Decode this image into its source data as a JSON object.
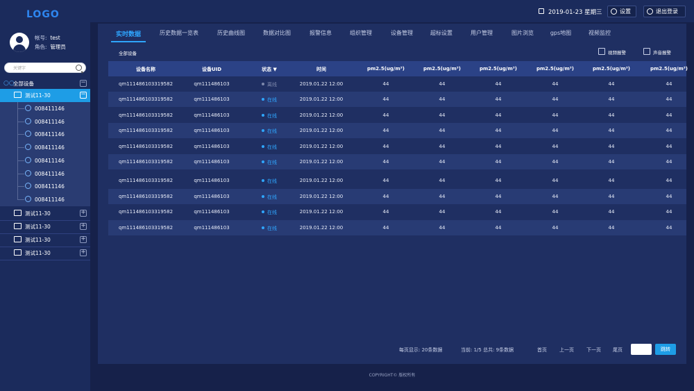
{
  "app": {
    "logo": "LOGO"
  },
  "user": {
    "account_label": "帐号:",
    "account": "test",
    "role_label": "角色:",
    "role": "管理员"
  },
  "search": {
    "placeholder": "关键字"
  },
  "tree": {
    "root": {
      "label": "全部设备",
      "toggle": "−"
    },
    "groups": [
      {
        "label": "测试11-30",
        "toggle": "−",
        "expanded": true
      },
      {
        "label": "测试11-30",
        "toggle": "+"
      },
      {
        "label": "测试11-30",
        "toggle": "+"
      },
      {
        "label": "测试11-30",
        "toggle": "+"
      },
      {
        "label": "测试11-30",
        "toggle": "+"
      }
    ],
    "devices": [
      "008411146",
      "008411146",
      "008411146",
      "008411146",
      "008411146",
      "008411146",
      "008411146",
      "008411146"
    ]
  },
  "topbar": {
    "date": "2019-01-23 星期三",
    "settings": "设置",
    "logout": "退出登录"
  },
  "tabs": [
    "实时数据",
    "历史数据一览表",
    "历史曲线图",
    "数据对比图",
    "报警信息",
    "组织管理",
    "设备管理",
    "超标设置",
    "用户管理",
    "图片浏览",
    "gps地图",
    "视频监控"
  ],
  "active_tab": 0,
  "subheader": {
    "title": "全部设备",
    "video_alarm": "视频报警",
    "sound_alarm": "声音报警"
  },
  "table": {
    "headers": [
      "设备名称",
      "设备UID",
      "状态 ▼",
      "时间",
      "pm2.5(ug/m³)",
      "pm2.5(ug/m³)",
      "pm2.5(ug/m³)",
      "pm2.5(ug/m³)",
      "pm2.5(ug/m³)",
      "pm2.5(ug/m³)"
    ],
    "rows": [
      {
        "name": "qm111486103319582",
        "uid": "qm111486103",
        "status": "离线",
        "online": false,
        "time": "2019.01.22  12:00",
        "vals": [
          "44",
          "44",
          "44",
          "44",
          "44",
          "44"
        ]
      },
      {
        "name": "qm111486103319582",
        "uid": "qm111486103",
        "status": "在线",
        "online": true,
        "time": "2019.01.22  12:00",
        "vals": [
          "44",
          "44",
          "44",
          "44",
          "44",
          "44"
        ]
      },
      {
        "name": "qm111486103319582",
        "uid": "qm111486103",
        "status": "在线",
        "online": true,
        "time": "2019.01.22  12:00",
        "vals": [
          "44",
          "44",
          "44",
          "44",
          "44",
          "44"
        ]
      },
      {
        "name": "qm111486103319582",
        "uid": "qm111486103",
        "status": "在线",
        "online": true,
        "time": "2019.01.22  12:00",
        "vals": [
          "44",
          "44",
          "44",
          "44",
          "44",
          "44"
        ]
      },
      {
        "name": "qm111486103319582",
        "uid": "qm111486103",
        "status": "在线",
        "online": true,
        "time": "2019.01.22  12:00",
        "vals": [
          "44",
          "44",
          "44",
          "44",
          "44",
          "44"
        ]
      },
      {
        "name": "qm111486103319582",
        "uid": "qm111486103",
        "status": "在线",
        "online": true,
        "time": "2019.01.22  12:00",
        "vals": [
          "44",
          "44",
          "44",
          "44",
          "44",
          "44"
        ]
      },
      {
        "name": "qm111486103319582",
        "uid": "qm111486103",
        "status": "在线",
        "online": true,
        "time": "2019.01.22  12:00",
        "vals": [
          "44",
          "44",
          "44",
          "44",
          "44",
          "44"
        ]
      },
      {
        "name": "qm111486103319582",
        "uid": "qm111486103",
        "status": "在线",
        "online": true,
        "time": "2019.01.22  12:00",
        "vals": [
          "44",
          "44",
          "44",
          "44",
          "44",
          "44"
        ]
      },
      {
        "name": "qm111486103319582",
        "uid": "qm111486103",
        "status": "在线",
        "online": true,
        "time": "2019.01.22  12:00",
        "vals": [
          "44",
          "44",
          "44",
          "44",
          "44",
          "44"
        ]
      },
      {
        "name": "qm111486103319582",
        "uid": "qm111486103",
        "status": "在线",
        "online": true,
        "time": "2019.01.22  12:00",
        "vals": [
          "44",
          "44",
          "44",
          "44",
          "44",
          "44"
        ]
      }
    ]
  },
  "pager": {
    "per_page": "每页显示:  20条数据",
    "current": "当前:  1/5  总共:  9条数据",
    "first": "首页",
    "prev": "上一页",
    "next": "下一页",
    "last": "尾页",
    "jump": "跳转",
    "jump_value": ""
  },
  "footer": {
    "copyright": "COPYRIGHT© 版权所有"
  },
  "colors": {
    "accent": "#2fa6ff",
    "active_group": "#1e9de6",
    "background": "#16214a"
  }
}
